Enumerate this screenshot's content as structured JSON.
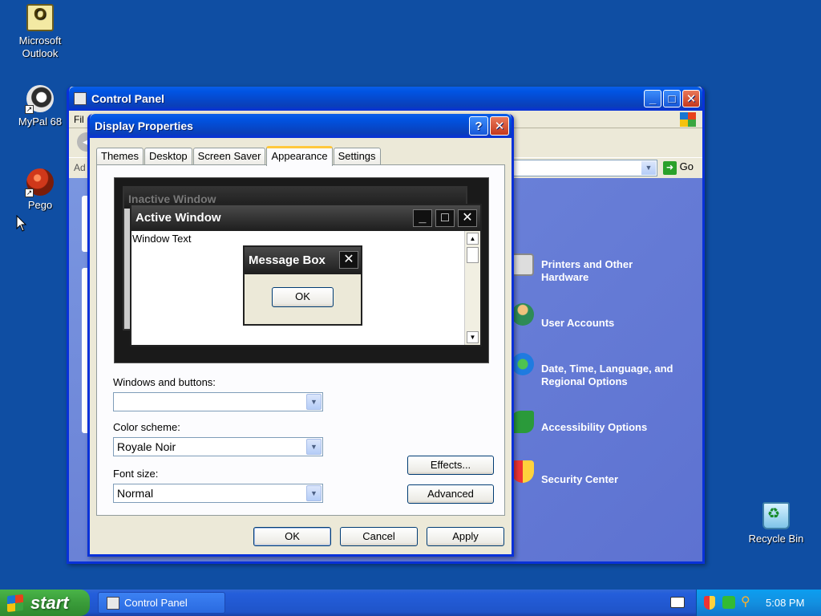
{
  "desktop": {
    "icons": [
      {
        "label": "Microsoft Outlook",
        "icon": "outlook-icon"
      },
      {
        "label": "MyPal 68",
        "icon": "mypal-icon"
      },
      {
        "label": "Pego",
        "icon": "pego-icon"
      },
      {
        "label": "Recycle Bin",
        "icon": "recycle-bin-icon"
      }
    ]
  },
  "control_panel": {
    "title": "Control Panel",
    "menu_partial": "Fil",
    "address_partial": "Ad",
    "go_label": "Go",
    "categories": [
      {
        "label": "Printers and Other Hardware",
        "icon": "printer-icon"
      },
      {
        "label": "User Accounts",
        "icon": "user-accounts-icon"
      },
      {
        "label": "Date, Time, Language, and Regional Options",
        "icon": "globe-clock-icon"
      },
      {
        "label": "Accessibility Options",
        "icon": "accessibility-icon"
      },
      {
        "label": "Security Center",
        "icon": "shield-icon"
      }
    ]
  },
  "display_properties": {
    "title": "Display Properties",
    "tabs": [
      "Themes",
      "Desktop",
      "Screen Saver",
      "Appearance",
      "Settings"
    ],
    "active_tab": "Appearance",
    "preview": {
      "inactive_title": "Inactive Window",
      "active_title": "Active Window",
      "window_text": "Window Text",
      "message_title": "Message Box",
      "message_ok": "OK"
    },
    "windows_buttons_label": "Windows and buttons:",
    "windows_buttons_value": "",
    "color_scheme_label": "Color scheme:",
    "color_scheme_value": "Royale Noir",
    "font_size_label": "Font size:",
    "font_size_value": "Normal",
    "effects_label": "Effects...",
    "advanced_label": "Advanced",
    "ok_label": "OK",
    "cancel_label": "Cancel",
    "apply_label": "Apply"
  },
  "taskbar": {
    "start_label": "start",
    "task_label": "Control Panel",
    "clock": "5:08 PM"
  }
}
